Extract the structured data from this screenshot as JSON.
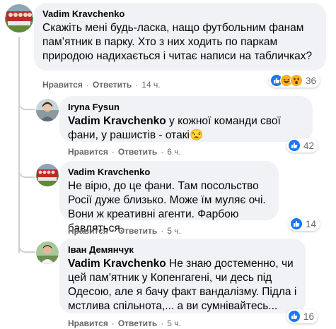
{
  "comments": [
    {
      "author": "Vadim Kravchenko",
      "mention": "",
      "text": "Скажіть мені будь-ласка, нащо футбольним фанам пам’ятник в парку. Хто з них ходить по паркам природою надихається і читає написи на табличках?",
      "like_label": "Нравится",
      "reply_label": "Ответить",
      "time": "14 ч.",
      "reaction_count": "36",
      "reactions": [
        "like-icon",
        "haha-icon",
        "wow-icon"
      ]
    },
    {
      "author": "Iryna Fysun",
      "mention": "Vadim Kravchenko",
      "text": " у кожної команди свої фани, у рашистів - отакі😒",
      "like_label": "Нравится",
      "reply_label": "Ответить",
      "time": "6 ч.",
      "reaction_count": "42",
      "reactions": [
        "like-icon"
      ]
    },
    {
      "author": "Vadim Kravchenko",
      "mention": "",
      "text": "Не вірю, до це фани. Там посольство Росії дуже близько. Може їм муляє очі. Вони ж креативні агенти. Фарбою бавляться.",
      "like_label": "Нравится",
      "reply_label": "Ответить",
      "time": "5 ч.",
      "reaction_count": "14",
      "reactions": [
        "like-icon"
      ]
    },
    {
      "author": "Іван Демянчук",
      "mention": "Vadim Kravchenko",
      "text": " Не знаю достеменно, чи цей пам'ятник у Копенгагені, чи десь під Одесою, але я бачу факт вандалізму. Підла і мстлива спільнота,... а ви сумнівайтесь...",
      "like_label": "Нравится",
      "reply_label": "Ответить",
      "time": "5 ч.",
      "reaction_count": "16",
      "reactions": [
        "like-icon"
      ]
    }
  ],
  "colors": {
    "bubble": "#f0f2f5",
    "meta": "#65676b",
    "like": "#1877f2",
    "haha": "#f7b125"
  }
}
